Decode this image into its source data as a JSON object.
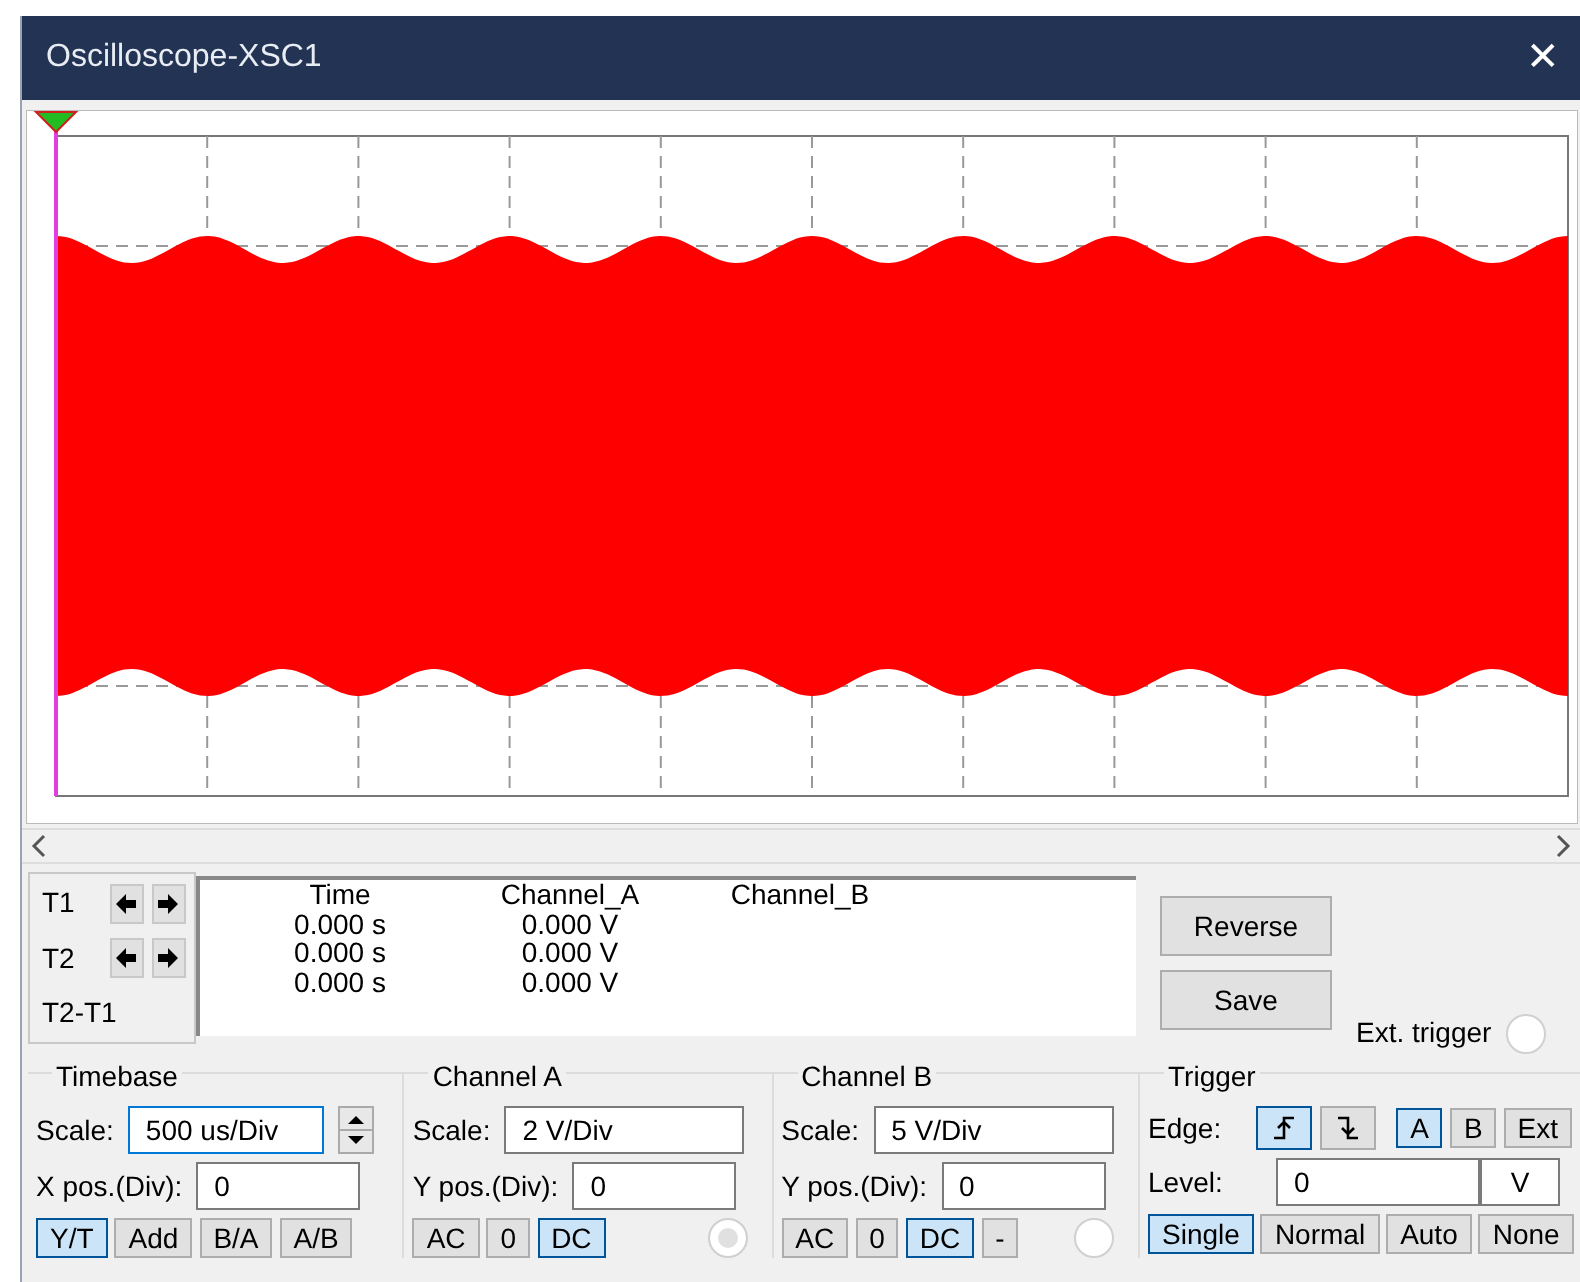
{
  "window": {
    "title": "Oscilloscope-XSC1",
    "close": "✕"
  },
  "cursors": [
    {
      "label": "T1",
      "arrows": true
    },
    {
      "label": "T2",
      "arrows": true
    },
    {
      "label": "T2-T1",
      "arrows": false
    }
  ],
  "readout": {
    "columns": [
      "Time",
      "Channel_A",
      "Channel_B"
    ],
    "rows": [
      [
        "0.000 s",
        "0.000 V",
        ""
      ],
      [
        "0.000 s",
        "0.000 V",
        ""
      ],
      [
        "0.000 s",
        "0.000 V",
        ""
      ]
    ]
  },
  "actions": [
    "Reverse",
    "Save"
  ],
  "ext_trigger": {
    "label": "Ext. trigger",
    "selected": false
  },
  "timebase": {
    "title": "Timebase",
    "scale_label": "Scale:",
    "scale_value": "500 us/Div",
    "focused": true,
    "pos_label": "X pos.(Div):",
    "pos_value": "0",
    "modes": [
      {
        "label": "Y/T",
        "selected": true
      },
      {
        "label": "Add",
        "selected": false
      },
      {
        "label": "B/A",
        "selected": false
      },
      {
        "label": "A/B",
        "selected": false
      }
    ]
  },
  "channel_a": {
    "title": "Channel A",
    "scale_label": "Scale:",
    "scale_value": "2  V/Div",
    "focused": false,
    "pos_label": "Y pos.(Div):",
    "pos_value": "0",
    "coupling": [
      {
        "label": "AC",
        "selected": false
      },
      {
        "label": "0",
        "selected": false
      },
      {
        "label": "DC",
        "selected": true
      }
    ],
    "radio_disabled": true
  },
  "channel_b": {
    "title": "Channel B",
    "scale_label": "Scale:",
    "scale_value": "5  V/Div",
    "focused": false,
    "pos_label": "Y pos.(Div):",
    "pos_value": "0",
    "coupling": [
      {
        "label": "AC",
        "selected": false
      },
      {
        "label": "0",
        "selected": false
      },
      {
        "label": "DC",
        "selected": true
      },
      {
        "label": "-",
        "selected": false
      }
    ],
    "radio_disabled": false
  },
  "trigger": {
    "title": "Trigger",
    "edge_label": "Edge:",
    "edges": [
      {
        "kind": "rising",
        "selected": true
      },
      {
        "kind": "falling",
        "selected": false
      }
    ],
    "sources": [
      {
        "label": "A",
        "selected": true
      },
      {
        "label": "B",
        "selected": false
      },
      {
        "label": "Ext",
        "selected": false
      }
    ],
    "level_label": "Level:",
    "level_value": "0",
    "level_unit": "V",
    "modes": [
      {
        "label": "Single",
        "selected": true
      },
      {
        "label": "Normal",
        "selected": false
      },
      {
        "label": "Auto",
        "selected": false
      },
      {
        "label": "None",
        "selected": false
      }
    ]
  }
}
